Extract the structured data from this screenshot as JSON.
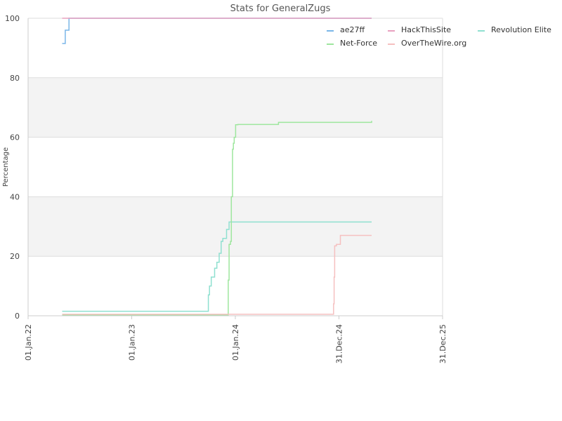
{
  "chart_data": {
    "type": "line",
    "title": "Stats for GeneralZugs",
    "xlabel": "",
    "ylabel": "Percentage",
    "xlim": [
      "2022-01-01",
      "2025-12-31"
    ],
    "ylim": [
      0,
      100
    ],
    "x_ticks": [
      "2022-01-01",
      "2023-01-01",
      "2024-01-01",
      "2024-12-31",
      "2025-12-31"
    ],
    "x_tick_labels": [
      "01.Jan.22",
      "01.Jan.23",
      "01.Jan.24",
      "31.Dec.24",
      "31.Dec.25"
    ],
    "y_ticks": [
      0,
      20,
      40,
      60,
      80,
      100
    ],
    "y_tick_labels": [
      "0",
      "20",
      "40",
      "60",
      "80",
      "100"
    ],
    "grid": true,
    "banded_background": true,
    "legend_position": "top-right",
    "series": [
      {
        "name": "ae27ff",
        "color": "#7ab6e8",
        "x": [
          "2022-05-01",
          "2022-05-12",
          "2022-05-25",
          "2022-06-15",
          "2025-04-25"
        ],
        "y": [
          91.5,
          96,
          100,
          100,
          100
        ]
      },
      {
        "name": "HackThisSite",
        "color": "#e8a0bf",
        "x": [
          "2022-05-01",
          "2025-04-25"
        ],
        "y": [
          100,
          100
        ]
      },
      {
        "name": "Revolution Elite",
        "color": "#8fe0d0",
        "x": [
          "2022-05-01",
          "2023-09-25",
          "2023-09-28",
          "2023-10-02",
          "2023-10-08",
          "2023-10-15",
          "2023-10-20",
          "2023-10-28",
          "2023-11-05",
          "2023-11-12",
          "2023-11-18",
          "2023-11-25",
          "2023-12-01",
          "2023-12-10",
          "2025-04-25"
        ],
        "y": [
          1.5,
          1.5,
          7,
          10,
          13,
          13,
          16,
          18,
          21,
          25,
          26,
          26,
          29,
          31.5,
          31.5
        ]
      },
      {
        "name": "Net-Force",
        "color": "#9ee69e",
        "x": [
          "2022-05-01",
          "2023-12-05",
          "2023-12-07",
          "2023-12-10",
          "2023-12-15",
          "2023-12-18",
          "2023-12-22",
          "2023-12-25",
          "2023-12-28",
          "2024-01-02",
          "2024-01-10",
          "2024-06-01",
          "2025-04-25"
        ],
        "y": [
          0.3,
          0.3,
          12,
          24,
          25,
          40,
          56,
          58,
          60,
          64.2,
          64.3,
          65,
          65.5
        ]
      },
      {
        "name": "OverTheWire.org",
        "color": "#f5c0c0",
        "x": [
          "2022-05-01",
          "2024-12-10",
          "2024-12-12",
          "2024-12-14",
          "2024-12-16",
          "2024-12-22",
          "2025-01-02",
          "2025-01-05",
          "2025-04-25"
        ],
        "y": [
          0.5,
          0.5,
          4,
          13,
          23.5,
          24,
          24,
          27,
          27
        ]
      }
    ]
  }
}
